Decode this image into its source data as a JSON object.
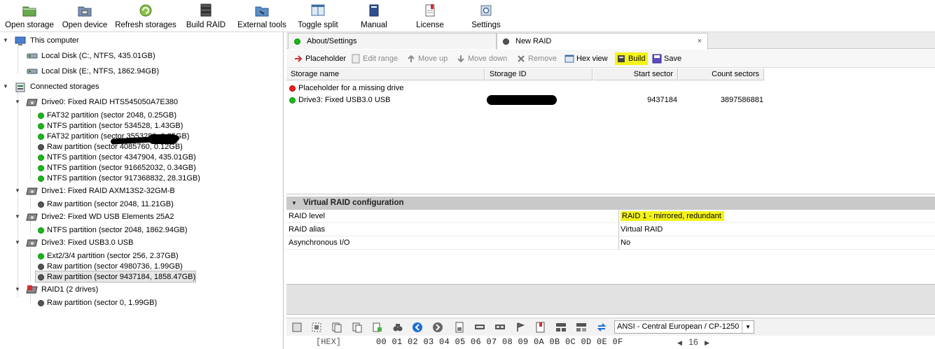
{
  "toolbar": {
    "buttons": [
      {
        "label": "Open storage",
        "icon": "open-storage-icon"
      },
      {
        "label": "Open device",
        "icon": "open-device-icon"
      },
      {
        "label": "Refresh storages",
        "icon": "refresh-icon"
      },
      {
        "label": "Build RAID",
        "icon": "build-raid-icon"
      },
      {
        "label": "External tools",
        "icon": "external-tools-icon"
      },
      {
        "label": "Toggle split",
        "icon": "toggle-split-icon"
      },
      {
        "label": "Manual",
        "icon": "manual-icon"
      },
      {
        "label": "License",
        "icon": "license-icon"
      },
      {
        "label": "Settings",
        "icon": "settings-icon"
      }
    ]
  },
  "tree": {
    "this_computer": "This computer",
    "local_c": "Local Disk (C:, NTFS, 435.01GB)",
    "local_e": "Local Disk (E:, NTFS, 1862.94GB)",
    "connected": "Connected storages",
    "drive0": "Drive0: Fixed  RAID HTS545050A7E380",
    "drive0_parts": [
      {
        "label": "FAT32 partition (sector 2048, 0.25GB)",
        "status": "green"
      },
      {
        "label": "NTFS partition (sector 534528, 1.43GB)",
        "status": "green"
      },
      {
        "label": "FAT32 partition (sector 3553280, 0.25GB)",
        "status": "green"
      },
      {
        "label": "Raw partition (sector 4085760, 0.12GB)",
        "status": "gray"
      },
      {
        "label": "NTFS partition (sector 4347904, 435.01GB)",
        "status": "green"
      },
      {
        "label": "NTFS partition (sector 916652032, 0.34GB)",
        "status": "green"
      },
      {
        "label": "NTFS partition (sector 917368832, 28.31GB)",
        "status": "green"
      }
    ],
    "drive1": "Drive1: Fixed  RAID AXM13S2-32GM-B",
    "drive1_parts": [
      {
        "label": "Raw partition (sector 2048, 11.21GB)",
        "status": "gray"
      }
    ],
    "drive2": "Drive2: Fixed WD USB Elements 25A2",
    "drive2_parts": [
      {
        "label": "NTFS partition (sector 2048, 1862.94GB)",
        "status": "green"
      }
    ],
    "drive3": "Drive3: Fixed USB3.0 USB",
    "drive3_parts": [
      {
        "label": "Ext2/3/4 partition (sector 256, 2.37GB)",
        "status": "green"
      },
      {
        "label": "Raw partition (sector 4980736, 1.99GB)",
        "status": "gray"
      },
      {
        "label": "Raw partition (sector 9437184, 1858.47GB)",
        "status": "gray"
      }
    ],
    "raid1": "RAID1 (2 drives)",
    "raid1_parts": [
      {
        "label": "Raw partition (sector 0, 1.99GB)",
        "status": "gray"
      }
    ]
  },
  "tabs": [
    {
      "label": "About/Settings",
      "active": false
    },
    {
      "label": "New RAID",
      "active": true
    }
  ],
  "raid_toolbar": {
    "placeholder": "Placeholder",
    "edit_range": "Edit range",
    "move_up": "Move up",
    "move_down": "Move down",
    "remove": "Remove",
    "hex_view": "Hex view",
    "build": "Build",
    "save": "Save"
  },
  "storage_table": {
    "headers": [
      "Storage name",
      "Storage ID",
      "Start sector",
      "Count sectors"
    ],
    "rows": [
      {
        "name": "Placeholder for a missing drive",
        "status": "red",
        "id": "",
        "start": "",
        "count": ""
      },
      {
        "name": "Drive3: Fixed USB3.0 USB",
        "status": "green",
        "id": "",
        "start": "9437184",
        "count": "3897586881"
      }
    ]
  },
  "config": {
    "title": "Virtual RAID configuration",
    "rows": [
      {
        "key": "RAID level",
        "value": "RAID 1 - mirrored, redundant"
      },
      {
        "key": "RAID alias",
        "value": "Virtual RAID"
      },
      {
        "key": "Asynchronous I/O",
        "value": "No"
      }
    ]
  },
  "hex": {
    "encoding": "ANSI - Central European / CP-1250",
    "label": "[HEX]",
    "columns": "00 01 02 03 04 05 06 07 08 09 0A 0B 0C 0D 0E 0F",
    "page_size": "16"
  },
  "colors": {
    "highlight": "#f3f31a",
    "status_green": "#18b818",
    "status_red": "#e22222",
    "status_gray": "#555555"
  }
}
